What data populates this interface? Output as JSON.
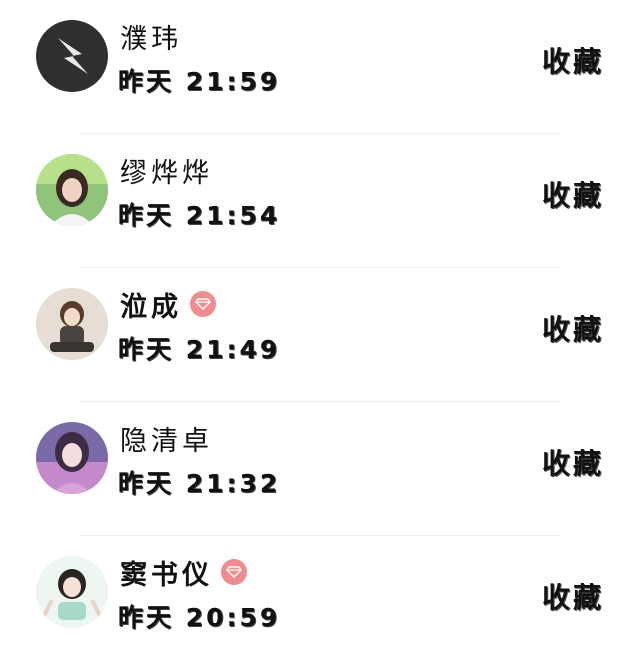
{
  "items": [
    {
      "name": "濮玮",
      "time": "昨天 21:59",
      "action": "收藏",
      "vip": false,
      "avatar_icon": "lightning-logo-icon",
      "avatar_color": "#2f2f2f"
    },
    {
      "name": "缪烨烨",
      "time": "昨天 21:54",
      "action": "收藏",
      "vip": false,
      "avatar_icon": "girl-photo-icon",
      "avatar_color": "#8fc47a"
    },
    {
      "name": "涖成",
      "time": "昨天 21:49",
      "action": "收藏",
      "vip": true,
      "avatar_icon": "anime-character-icon",
      "avatar_color": "#d8cfc4"
    },
    {
      "name": "隐清卓",
      "time": "昨天 21:32",
      "action": "收藏",
      "vip": false,
      "avatar_icon": "anime-girl-icon",
      "avatar_color": "#8f7ab8"
    },
    {
      "name": "窦书仪",
      "time": "昨天 20:59",
      "action": "收藏",
      "vip": true,
      "avatar_icon": "child-photo-icon",
      "avatar_color": "#a8d8c8"
    }
  ],
  "vip_icon": "diamond-icon",
  "vip_color": "#f08c8f"
}
